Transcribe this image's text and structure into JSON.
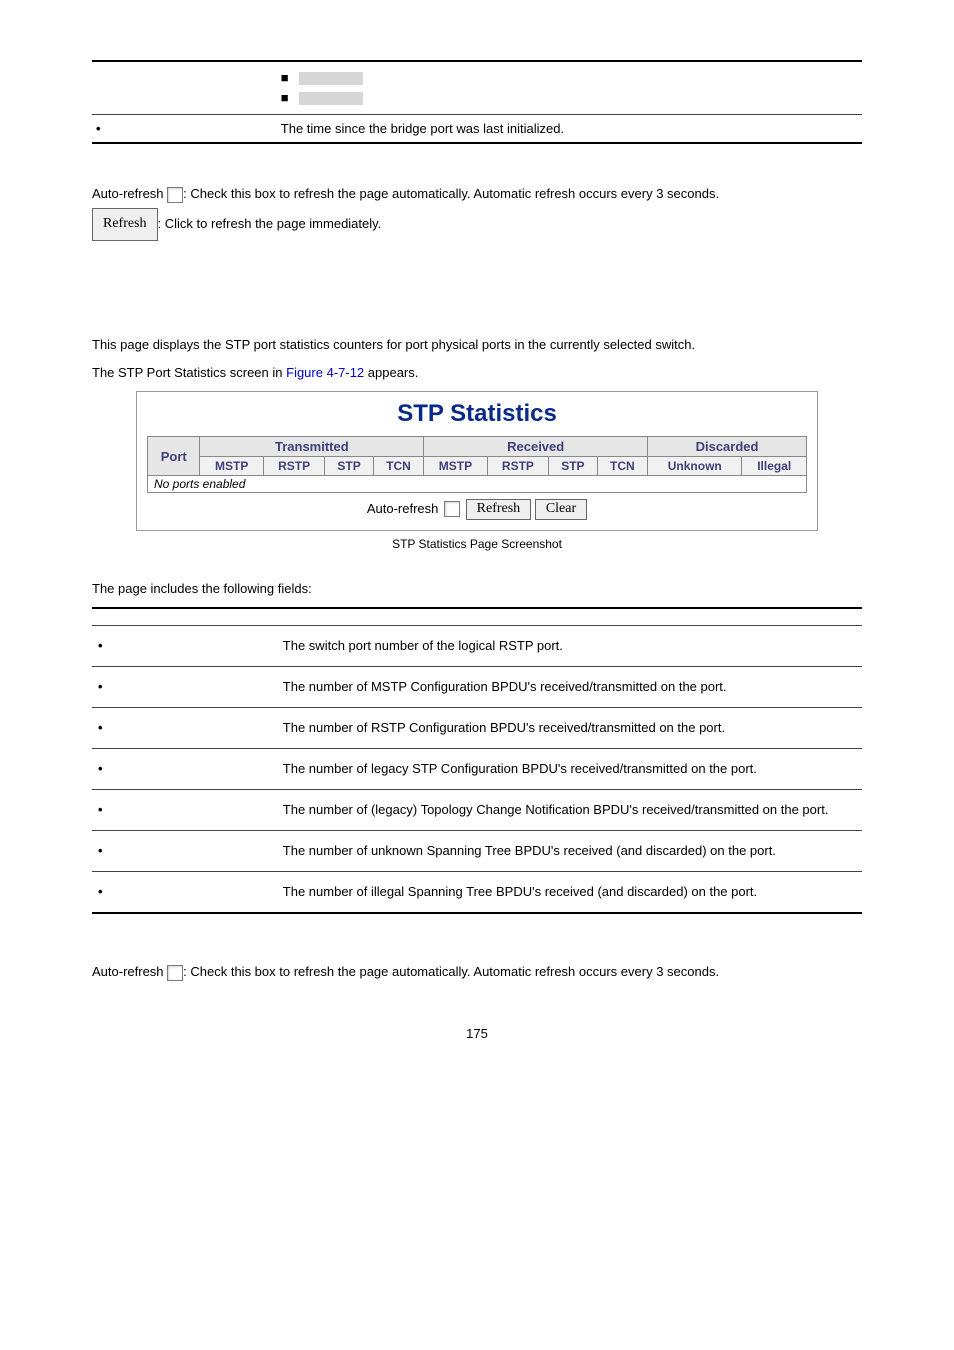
{
  "top_table": {
    "uptime_desc": "The time since the bridge port was last initialized."
  },
  "intro": {
    "autorefresh_prefix": "Auto-refresh ",
    "autorefresh_suffix": ": Check this box to refresh the page automatically. Automatic refresh occurs every 3 seconds.",
    "refresh_btn": "Refresh",
    "refresh_suffix": ": Click to refresh the page immediately."
  },
  "body": {
    "para1": "This page displays the STP port statistics counters for port physical ports in the currently selected switch.",
    "para2_a": "The STP Port Statistics screen in ",
    "para2_link": "Figure 4-7-12",
    "para2_b": " appears."
  },
  "stp": {
    "title": "STP Statistics",
    "port": "Port",
    "grp_tx": "Transmitted",
    "grp_rx": "Received",
    "grp_disc": "Discarded",
    "cols": {
      "mstp": "MSTP",
      "rstp": "RSTP",
      "stp": "STP",
      "tcn": "TCN",
      "unknown": "Unknown",
      "illegal": "Illegal"
    },
    "noports": "No ports enabled",
    "controls": {
      "autorefresh": "Auto-refresh",
      "refresh": "Refresh",
      "clear": "Clear"
    },
    "caption": "STP Statistics Page Screenshot"
  },
  "fields_intro": "The page includes the following fields:",
  "fields": [
    {
      "desc": "The switch port number of the logical RSTP port."
    },
    {
      "desc": "The number of MSTP Configuration BPDU's received/transmitted on the port."
    },
    {
      "desc": "The number of RSTP Configuration BPDU's received/transmitted on the port."
    },
    {
      "desc": "The number of legacy STP Configuration BPDU's received/transmitted on the port."
    },
    {
      "desc": "The number of (legacy) Topology Change Notification BPDU's received/transmitted on the port."
    },
    {
      "desc": "The number of unknown Spanning Tree BPDU's received (and discarded) on the port."
    },
    {
      "desc": "The number of illegal Spanning Tree BPDU's received (and discarded) on the port."
    }
  ],
  "outro": {
    "autorefresh_prefix": "Auto-refresh ",
    "autorefresh_suffix": ": Check this box to refresh the page automatically. Automatic refresh occurs every 3 seconds."
  },
  "page_num": "175"
}
